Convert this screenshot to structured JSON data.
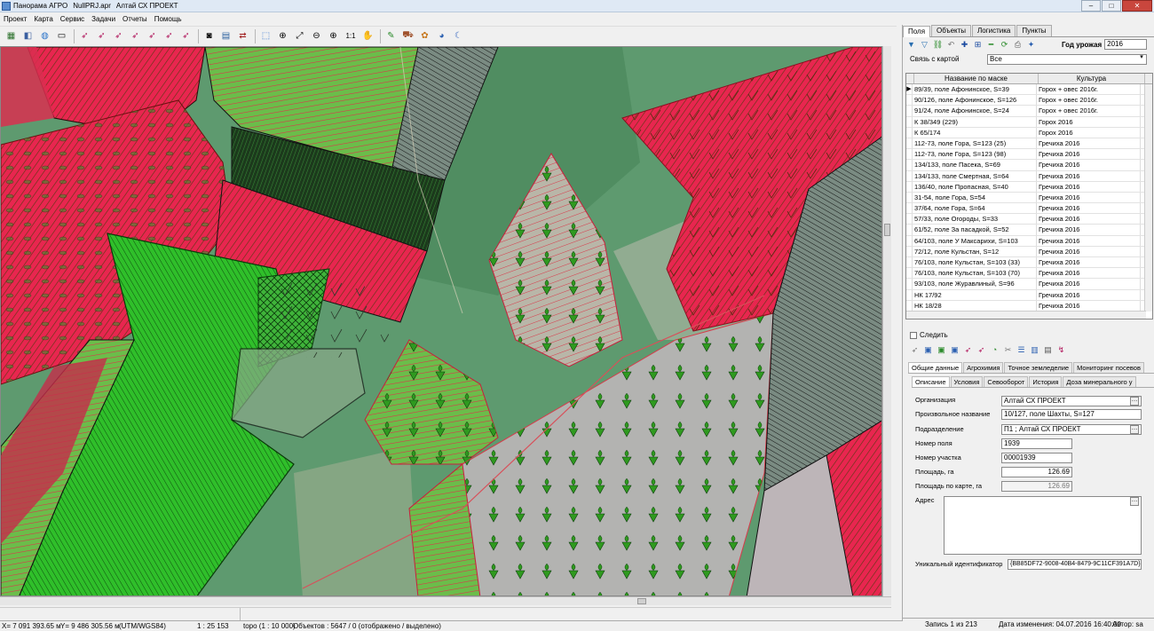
{
  "titlebar": {
    "app_title": "Панорама АГРО",
    "file_name": "NullPRJ.apr",
    "org": "Алтай СХ ПРОЕКТ"
  },
  "menu": [
    "Проект",
    "Карта",
    "Сервис",
    "Задачи",
    "Отчеты",
    "Помощь"
  ],
  "toolbar": {
    "zoom_label": "1:1"
  },
  "status": {
    "x_coord": "X= 7 091 393.65 м",
    "y_coord": "Y= 9 486 305.56 м",
    "projection": "(UTM/WGS84)",
    "scale": "1 : 25 153",
    "layer_info": "topo (1 : 10 000)",
    "objects": "Объектов : 5647 / 0 (отображено / выделено)"
  },
  "right_panel": {
    "tabs": [
      "Поля",
      "Объекты",
      "Логистика",
      "Пункты"
    ],
    "active_tab": "Поля",
    "year_label": "Год урожая",
    "year_value": "2016",
    "map_link_label": "Связь с картой",
    "map_link_value": "Все",
    "grid": {
      "col_name": "Название по маске",
      "col_crop": "Культура",
      "rows": [
        {
          "name": "89/39, поле Афонинское, S=39",
          "crop": "Горох + овес 2016г."
        },
        {
          "name": "90/126, поле Афонинское, S=126",
          "crop": "Горох + овес 2016г."
        },
        {
          "name": "91/24, поле Афонинское, S=24",
          "crop": "Горох + овес 2016г."
        },
        {
          "name": "К 38/349 (229)",
          "crop": "Горох 2016"
        },
        {
          "name": "К 65/174",
          "crop": "Горох 2016"
        },
        {
          "name": "112-73, поле Гора, S=123 (25)",
          "crop": "Гречиха 2016"
        },
        {
          "name": "112-73, поле Гора, S=123 (98)",
          "crop": "Гречиха 2016"
        },
        {
          "name": "134/133, поле Пасека, S=69",
          "crop": "Гречиха 2016"
        },
        {
          "name": "134/133, поле Смертная, S=64",
          "crop": "Гречиха 2016"
        },
        {
          "name": "136/40, поле Пропасная, S=40",
          "crop": "Гречиха 2016"
        },
        {
          "name": "31-54, поле Гора, S=54",
          "crop": "Гречиха 2016"
        },
        {
          "name": "37/64, поле Гора, S=64",
          "crop": "Гречиха 2016"
        },
        {
          "name": "57/33, поле Огороды, S=33",
          "crop": "Гречиха 2016"
        },
        {
          "name": "61/52, поле За пасадкой, S=52",
          "crop": "Гречиха 2016"
        },
        {
          "name": "64/103, поле У Максарихи, S=103",
          "crop": "Гречиха 2016"
        },
        {
          "name": "72/12, поле Кульстан, S=12",
          "crop": "Гречиха 2016"
        },
        {
          "name": "76/103, поле Кульстан, S=103 (33)",
          "crop": "Гречиха 2016"
        },
        {
          "name": "76/103, поле Кульстан, S=103 (70)",
          "crop": "Гречиха 2016"
        },
        {
          "name": "93/103, поле Журавлиный, S=96",
          "crop": "Гречиха 2016"
        },
        {
          "name": "НК 17/92",
          "crop": "Гречиха 2016"
        },
        {
          "name": "НК 18/28",
          "crop": "Гречиха 2016"
        }
      ]
    },
    "follow_label": "Следить",
    "detail_tabs": [
      "Общие данные",
      "Агрохимия",
      "Точное земледелие",
      "Мониторинг посевов"
    ],
    "sub_tabs": [
      "Описание",
      "Условия",
      "Севооборот",
      "История",
      "Доза минерального у"
    ],
    "form": {
      "org_label": "Организация",
      "org_value": "Алтай СХ ПРОЕКТ",
      "name_label": "Произвольное название",
      "name_value": "10/127, поле Шахты, S=127",
      "dept_label": "Подразделение",
      "dept_value": "П1 ; Алтай СХ ПРОЕКТ",
      "field_no_label": "Номер поля",
      "field_no_value": "1939",
      "plot_no_label": "Номер участка",
      "plot_no_value": "00001939",
      "area_label": "Площадь, га",
      "area_value": "126.69",
      "map_area_label": "Площадь по карте, га",
      "map_area_value": "126.69",
      "address_label": "Адрес",
      "address_value": "",
      "uid_label": "Уникальный идентификатор",
      "uid_value": "{BB85DF72-9008-40B4-8479-9C11CF391A7D}"
    },
    "footer": {
      "record": "Запись 1 из 213",
      "changed": "Дата изменения: 04.07.2016 16:40:00",
      "author": "Автор: sa"
    }
  },
  "colors": {
    "field_red": "#e8264f",
    "field_green": "#2fbf2a",
    "sat_green": "#5e9a6f",
    "sat_grey": "#b3b3b1"
  }
}
